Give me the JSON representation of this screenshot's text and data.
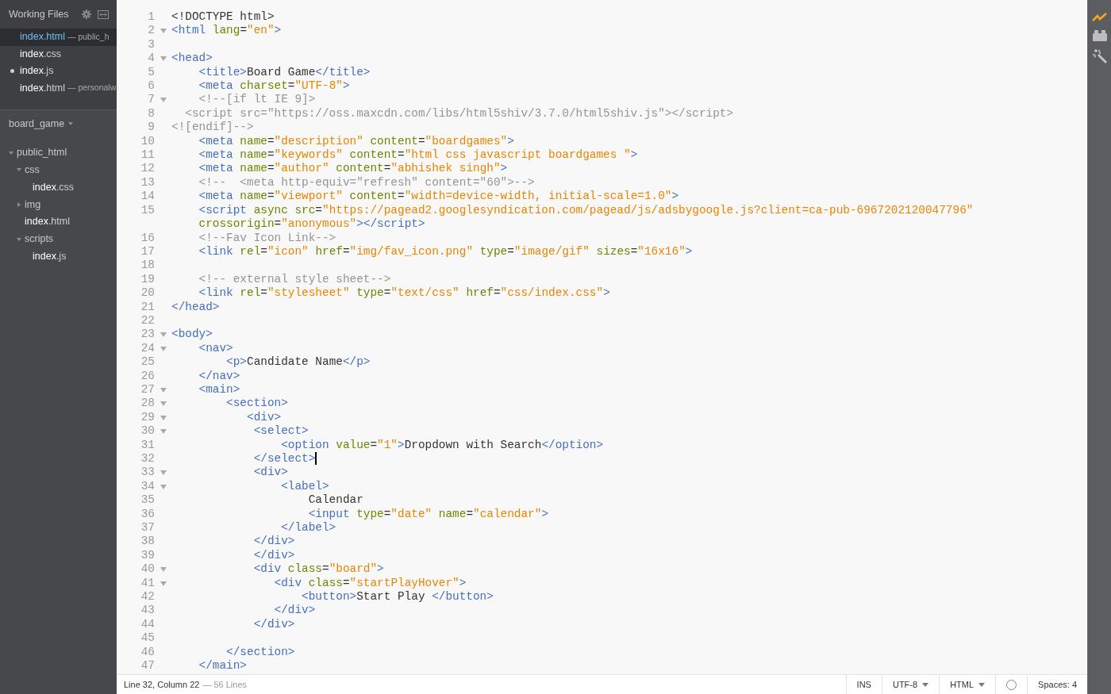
{
  "sidebar": {
    "working_files": {
      "title": "Working Files",
      "items": [
        {
          "name": "index",
          "ext": ".html",
          "dir": "— public_h",
          "selected": true,
          "modified": false
        },
        {
          "name": "index",
          "ext": ".css",
          "selected": false,
          "modified": false
        },
        {
          "name": "index",
          "ext": ".js",
          "selected": false,
          "modified": true
        },
        {
          "name": "index",
          "ext": ".html",
          "dir": "— personalw",
          "selected": false,
          "modified": false
        }
      ]
    },
    "project": {
      "title": "board_game",
      "tree": [
        {
          "kind": "folder",
          "name": "public_html",
          "expanded": true,
          "children": [
            {
              "kind": "folder",
              "name": "css",
              "expanded": true,
              "children": [
                {
                  "kind": "file",
                  "name": "index",
                  "ext": ".css"
                }
              ]
            },
            {
              "kind": "folder",
              "name": "img",
              "expanded": false
            },
            {
              "kind": "file",
              "name": "index",
              "ext": ".html"
            },
            {
              "kind": "folder",
              "name": "scripts",
              "expanded": true,
              "children": [
                {
                  "kind": "file",
                  "name": "index",
                  "ext": ".js"
                }
              ]
            }
          ]
        }
      ]
    }
  },
  "editor": {
    "lines": [
      {
        "n": "1",
        "fold": false,
        "cursor": false,
        "tokens": [
          {
            "kind": "text",
            "text": "<!DOCTYPE html>"
          }
        ]
      },
      {
        "n": "2",
        "fold": true,
        "cursor": false,
        "tokens": [
          {
            "kind": "tag",
            "text": "<html"
          },
          {
            "kind": "attr",
            "text": " lang"
          },
          {
            "kind": "text",
            "text": "="
          },
          {
            "kind": "string",
            "text": "\"en\""
          },
          {
            "kind": "tag",
            "text": ">"
          }
        ]
      },
      {
        "n": "3",
        "fold": false,
        "cursor": false
      },
      {
        "n": "4",
        "fold": true,
        "cursor": false,
        "tokens": [
          {
            "kind": "tag",
            "text": "<head>"
          }
        ]
      },
      {
        "n": "5",
        "fold": false,
        "cursor": false,
        "tokens": [
          {
            "kind": "tag",
            "text": "    <title>"
          },
          {
            "kind": "text",
            "text": "Board Game"
          },
          {
            "kind": "tag",
            "text": "</title>"
          }
        ]
      },
      {
        "n": "6",
        "fold": false,
        "cursor": false,
        "tokens": [
          {
            "kind": "tag",
            "text": "    <meta"
          },
          {
            "kind": "attr",
            "text": " charset"
          },
          {
            "kind": "text",
            "text": "="
          },
          {
            "kind": "string",
            "text": "\"UTF-8\""
          },
          {
            "kind": "tag",
            "text": ">"
          }
        ]
      },
      {
        "n": "7",
        "fold": true,
        "cursor": false,
        "tokens": [
          {
            "kind": "comment",
            "text": "    <!--[if lt IE 9]>"
          }
        ]
      },
      {
        "n": "8",
        "fold": false,
        "cursor": false,
        "tokens": [
          {
            "kind": "comment",
            "text": "  <script src=\"https://oss.maxcdn.com/libs/html5shiv/3.7.0/html5shiv.js\"></script>"
          }
        ]
      },
      {
        "n": "9",
        "fold": false,
        "cursor": false,
        "tokens": [
          {
            "kind": "comment",
            "text": "<![endif]-->"
          }
        ]
      },
      {
        "n": "10",
        "fold": false,
        "cursor": false,
        "tokens": [
          {
            "kind": "tag",
            "text": "    <meta"
          },
          {
            "kind": "attr",
            "text": " name"
          },
          {
            "kind": "text",
            "text": "="
          },
          {
            "kind": "string",
            "text": "\"description\""
          },
          {
            "kind": "attr",
            "text": " content"
          },
          {
            "kind": "text",
            "text": "="
          },
          {
            "kind": "string",
            "text": "\"boardgames\""
          },
          {
            "kind": "tag",
            "text": ">"
          }
        ]
      },
      {
        "n": "11",
        "fold": false,
        "cursor": false,
        "tokens": [
          {
            "kind": "tag",
            "text": "    <meta"
          },
          {
            "kind": "attr",
            "text": " name"
          },
          {
            "kind": "text",
            "text": "="
          },
          {
            "kind": "string",
            "text": "\"keywords\""
          },
          {
            "kind": "attr",
            "text": " content"
          },
          {
            "kind": "text",
            "text": "="
          },
          {
            "kind": "string",
            "text": "\"html css javascript boardgames \""
          },
          {
            "kind": "tag",
            "text": ">"
          }
        ]
      },
      {
        "n": "12",
        "fold": false,
        "cursor": false,
        "tokens": [
          {
            "kind": "tag",
            "text": "    <meta"
          },
          {
            "kind": "attr",
            "text": " name"
          },
          {
            "kind": "text",
            "text": "="
          },
          {
            "kind": "string",
            "text": "\"author\""
          },
          {
            "kind": "attr",
            "text": " content"
          },
          {
            "kind": "text",
            "text": "="
          },
          {
            "kind": "string",
            "text": "\"abhishek singh\""
          },
          {
            "kind": "tag",
            "text": ">"
          }
        ]
      },
      {
        "n": "13",
        "fold": false,
        "cursor": false,
        "tokens": [
          {
            "kind": "comment",
            "text": "    <!--  <meta http-equiv=\"refresh\" content=\"60\">-->"
          }
        ]
      },
      {
        "n": "14",
        "fold": false,
        "cursor": false,
        "tokens": [
          {
            "kind": "tag",
            "text": "    <meta"
          },
          {
            "kind": "attr",
            "text": " name"
          },
          {
            "kind": "text",
            "text": "="
          },
          {
            "kind": "string",
            "text": "\"viewport\""
          },
          {
            "kind": "attr",
            "text": " content"
          },
          {
            "kind": "text",
            "text": "="
          },
          {
            "kind": "string",
            "text": "\"width=device-width, initial-scale=1.0\""
          },
          {
            "kind": "tag",
            "text": ">"
          }
        ]
      },
      {
        "n": "15",
        "fold": false,
        "cursor": false,
        "tokens": [
          {
            "kind": "tag",
            "text": "    <script"
          },
          {
            "kind": "attr",
            "text": " async src"
          },
          {
            "kind": "text",
            "text": "="
          },
          {
            "kind": "string",
            "text": "\"https://pagead2.googlesyndication.com/pagead/js/adsbygoogle.js?client=ca-pub-6967202120047796\""
          }
        ],
        "wrap": [
          {
            "kind": "attr",
            "text": "    crossorigin"
          },
          {
            "kind": "text",
            "text": "="
          },
          {
            "kind": "string",
            "text": "\"anonymous\""
          },
          {
            "kind": "tag",
            "text": "></script>"
          }
        ]
      },
      {
        "n": "16",
        "fold": false,
        "cursor": false,
        "tokens": [
          {
            "kind": "comment",
            "text": "    <!--Fav Icon Link-->"
          }
        ]
      },
      {
        "n": "17",
        "fold": false,
        "cursor": false,
        "tokens": [
          {
            "kind": "tag",
            "text": "    <link"
          },
          {
            "kind": "attr",
            "text": " rel"
          },
          {
            "kind": "text",
            "text": "="
          },
          {
            "kind": "string",
            "text": "\"icon\""
          },
          {
            "kind": "attr",
            "text": " href"
          },
          {
            "kind": "text",
            "text": "="
          },
          {
            "kind": "string",
            "text": "\"img/fav_icon.png\""
          },
          {
            "kind": "attr",
            "text": " type"
          },
          {
            "kind": "text",
            "text": "="
          },
          {
            "kind": "string",
            "text": "\"image/gif\""
          },
          {
            "kind": "attr",
            "text": " sizes"
          },
          {
            "kind": "text",
            "text": "="
          },
          {
            "kind": "string",
            "text": "\"16x16\""
          },
          {
            "kind": "tag",
            "text": ">"
          }
        ]
      },
      {
        "n": "18",
        "fold": false,
        "cursor": false
      },
      {
        "n": "19",
        "fold": false,
        "cursor": false,
        "tokens": [
          {
            "kind": "comment",
            "text": "    <!-- external style sheet-->"
          }
        ]
      },
      {
        "n": "20",
        "fold": false,
        "cursor": false,
        "tokens": [
          {
            "kind": "tag",
            "text": "    <link"
          },
          {
            "kind": "attr",
            "text": " rel"
          },
          {
            "kind": "text",
            "text": "="
          },
          {
            "kind": "string",
            "text": "\"stylesheet\""
          },
          {
            "kind": "attr",
            "text": " type"
          },
          {
            "kind": "text",
            "text": "="
          },
          {
            "kind": "string",
            "text": "\"text/css\""
          },
          {
            "kind": "attr",
            "text": " href"
          },
          {
            "kind": "text",
            "text": "="
          },
          {
            "kind": "string",
            "text": "\"css/index.css\""
          },
          {
            "kind": "tag",
            "text": ">"
          }
        ]
      },
      {
        "n": "21",
        "fold": false,
        "cursor": false,
        "tokens": [
          {
            "kind": "tag",
            "text": "</head>"
          }
        ]
      },
      {
        "n": "22",
        "fold": false,
        "cursor": false
      },
      {
        "n": "23",
        "fold": true,
        "cursor": false,
        "tokens": [
          {
            "kind": "tag",
            "text": "<body>"
          }
        ]
      },
      {
        "n": "24",
        "fold": true,
        "cursor": false,
        "tokens": [
          {
            "kind": "tag",
            "text": "    <nav>"
          }
        ]
      },
      {
        "n": "25",
        "fold": false,
        "cursor": false,
        "tokens": [
          {
            "kind": "tag",
            "text": "        <p>"
          },
          {
            "kind": "text",
            "text": "Candidate Name"
          },
          {
            "kind": "tag",
            "text": "</p>"
          }
        ]
      },
      {
        "n": "26",
        "fold": false,
        "cursor": false,
        "tokens": [
          {
            "kind": "tag",
            "text": "    </nav>"
          }
        ]
      },
      {
        "n": "27",
        "fold": true,
        "cursor": false,
        "tokens": [
          {
            "kind": "tag",
            "text": "    <main>"
          }
        ]
      },
      {
        "n": "28",
        "fold": true,
        "cursor": false,
        "tokens": [
          {
            "kind": "tag",
            "text": "        <section>"
          }
        ]
      },
      {
        "n": "29",
        "fold": true,
        "cursor": false,
        "tokens": [
          {
            "kind": "tag",
            "text": "           <div>"
          }
        ]
      },
      {
        "n": "30",
        "fold": true,
        "cursor": false,
        "tokens": [
          {
            "kind": "tag",
            "text": "            <select>"
          }
        ]
      },
      {
        "n": "31",
        "fold": false,
        "cursor": false,
        "tokens": [
          {
            "kind": "tag",
            "text": "                <option"
          },
          {
            "kind": "attr",
            "text": " value"
          },
          {
            "kind": "text",
            "text": "="
          },
          {
            "kind": "string",
            "text": "\"1\""
          },
          {
            "kind": "tag",
            "text": ">"
          },
          {
            "kind": "text",
            "text": "Dropdown with Search"
          },
          {
            "kind": "tag",
            "text": "</option>"
          }
        ]
      },
      {
        "n": "32",
        "fold": false,
        "cursor": true,
        "tokens": [
          {
            "kind": "tag",
            "text": "            </select>"
          }
        ]
      },
      {
        "n": "33",
        "fold": true,
        "cursor": false,
        "tokens": [
          {
            "kind": "tag",
            "text": "            <div>"
          }
        ]
      },
      {
        "n": "34",
        "fold": true,
        "cursor": false,
        "tokens": [
          {
            "kind": "tag",
            "text": "                <label>"
          }
        ]
      },
      {
        "n": "35",
        "fold": false,
        "cursor": false,
        "tokens": [
          {
            "kind": "text",
            "text": "                    Calendar"
          }
        ]
      },
      {
        "n": "36",
        "fold": false,
        "cursor": false,
        "tokens": [
          {
            "kind": "tag",
            "text": "                    <input"
          },
          {
            "kind": "attr",
            "text": " type"
          },
          {
            "kind": "text",
            "text": "="
          },
          {
            "kind": "string",
            "text": "\"date\""
          },
          {
            "kind": "attr",
            "text": " name"
          },
          {
            "kind": "text",
            "text": "="
          },
          {
            "kind": "string",
            "text": "\"calendar\""
          },
          {
            "kind": "tag",
            "text": ">"
          }
        ]
      },
      {
        "n": "37",
        "fold": false,
        "cursor": false,
        "tokens": [
          {
            "kind": "tag",
            "text": "                </label>"
          }
        ]
      },
      {
        "n": "38",
        "fold": false,
        "cursor": false,
        "tokens": [
          {
            "kind": "tag",
            "text": "            </div>"
          }
        ]
      },
      {
        "n": "39",
        "fold": false,
        "cursor": false,
        "tokens": [
          {
            "kind": "tag",
            "text": "            </div>"
          }
        ]
      },
      {
        "n": "40",
        "fold": true,
        "cursor": false,
        "tokens": [
          {
            "kind": "tag",
            "text": "            <div"
          },
          {
            "kind": "attr",
            "text": " class"
          },
          {
            "kind": "text",
            "text": "="
          },
          {
            "kind": "string",
            "text": "\"board\""
          },
          {
            "kind": "tag",
            "text": ">"
          }
        ]
      },
      {
        "n": "41",
        "fold": true,
        "cursor": false,
        "tokens": [
          {
            "kind": "tag",
            "text": "               <div"
          },
          {
            "kind": "attr",
            "text": " class"
          },
          {
            "kind": "text",
            "text": "="
          },
          {
            "kind": "string",
            "text": "\"startPlayHover\""
          },
          {
            "kind": "tag",
            "text": ">"
          }
        ]
      },
      {
        "n": "42",
        "fold": false,
        "cursor": false,
        "tokens": [
          {
            "kind": "tag",
            "text": "                   <button>"
          },
          {
            "kind": "text",
            "text": "Start Play "
          },
          {
            "kind": "tag",
            "text": "</button>"
          }
        ]
      },
      {
        "n": "43",
        "fold": false,
        "cursor": false,
        "tokens": [
          {
            "kind": "tag",
            "text": "               </div>"
          }
        ]
      },
      {
        "n": "44",
        "fold": false,
        "cursor": false,
        "tokens": [
          {
            "kind": "tag",
            "text": "            </div>"
          }
        ]
      },
      {
        "n": "45",
        "fold": false,
        "cursor": false
      },
      {
        "n": "46",
        "fold": false,
        "cursor": false,
        "tokens": [
          {
            "kind": "tag",
            "text": "        </section>"
          }
        ]
      },
      {
        "n": "47",
        "fold": false,
        "cursor": false,
        "tokens": [
          {
            "kind": "tag",
            "text": "    </main>"
          }
        ]
      }
    ]
  },
  "status_bar": {
    "position": "Line 32, Column 22",
    "line_count": "— 56 Lines",
    "mode": "INS",
    "encoding": "UTF-8",
    "language": "HTML",
    "indent": "Spaces: 4"
  }
}
